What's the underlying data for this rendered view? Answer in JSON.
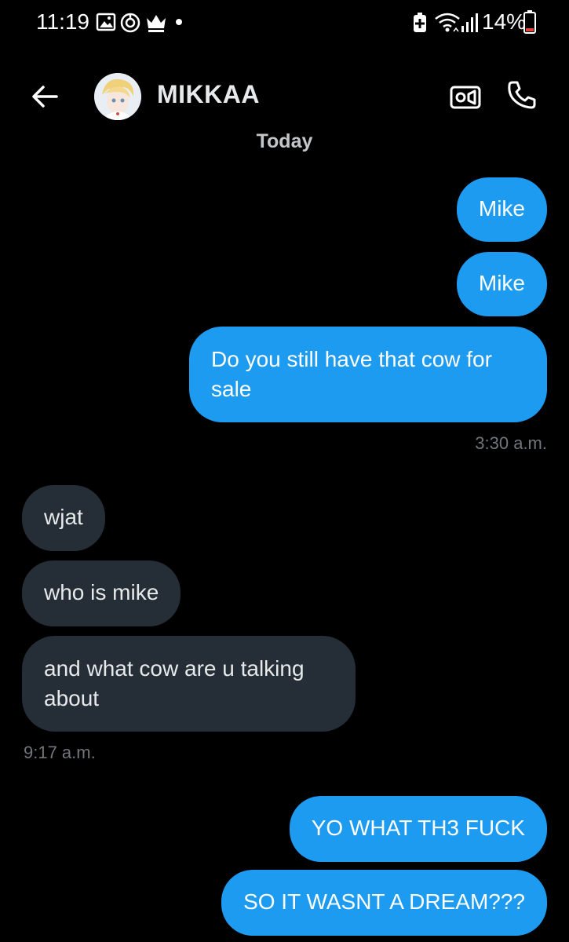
{
  "status_bar": {
    "time": "11:19",
    "battery": "14%",
    "battery_low_color": "#e0463d",
    "icons": [
      "gallery-icon",
      "sync-icon",
      "crown-icon",
      "notification-dot",
      "battery-saver-icon",
      "wifi-icon",
      "signal-icon",
      "battery-icon"
    ]
  },
  "header": {
    "contact_name": "MIKKAA",
    "icons": [
      "back-arrow-icon",
      "video-call-icon",
      "phone-call-icon"
    ]
  },
  "conversation": {
    "date_divider": "Today",
    "messages": [
      {
        "from": "me",
        "text": "Mike"
      },
      {
        "from": "me",
        "text": "Mike"
      },
      {
        "from": "me",
        "text": "Do you still have that cow for\nsale"
      },
      {
        "timestamp": "3:30 a.m."
      },
      {
        "from": "them",
        "text": "wjat"
      },
      {
        "from": "them",
        "text": "who is mike"
      },
      {
        "from": "them",
        "text": "and what cow are u talking\nabout"
      },
      {
        "timestamp": "9:17 a.m."
      },
      {
        "from": "me",
        "text": "YO WHAT TH3 FUCK"
      },
      {
        "from": "me",
        "text": "SO IT WASNT A DREAM???"
      }
    ]
  },
  "colors": {
    "background": "#000000",
    "sent_bubble": "#1d9bf0",
    "received_bubble": "#252e36",
    "timestamp": "#71767b"
  }
}
